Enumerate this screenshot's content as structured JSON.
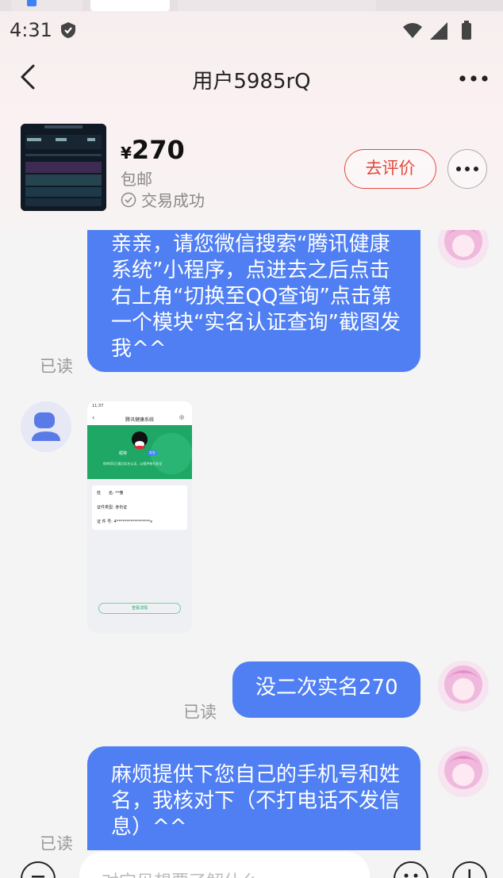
{
  "status_bar": {
    "time": "4:31"
  },
  "header": {
    "title": "用户5985rQ"
  },
  "order": {
    "currency": "¥",
    "price": "270",
    "shipping": "包邮",
    "status": "交易成功",
    "rate_button": "去评价"
  },
  "messages": [
    {
      "side": "right",
      "text": "亲亲，请您微信搜索“腾讯健康系统”小程序，点进去之后点击右上角“切换至QQ查询”点击第一个模块“实名认证查询”截图发我^^",
      "read": "已读"
    },
    {
      "side": "left",
      "type": "image"
    },
    {
      "side": "right",
      "text": "没二次实名270",
      "read": "已读"
    },
    {
      "side": "right",
      "text": "麻烦提供下您自己的手机号和姓名，我核对下（不打电话不发信息）^^",
      "read": "已读"
    }
  ],
  "screenshot_msg": {
    "time": "11:37",
    "app_title": "腾讯健康系统",
    "nickname": "昵称",
    "tag": "实名",
    "desc": "你的QQ已通过实名认证，以保护账号安全",
    "rows": [
      {
        "label": "姓　　名:",
        "value": "**懂"
      },
      {
        "label": "证件类型:",
        "value": "身份证"
      },
      {
        "label": "证 件 号:",
        "value": "4*****************x"
      }
    ],
    "button": "查看详情"
  },
  "input": {
    "placeholder": "对宝贝想要了解什么"
  },
  "icons": {
    "back": "back-arrow-icon",
    "more": "more-horizontal-icon",
    "check": "check-circle-icon",
    "menu": "menu-circle-icon",
    "emoji": "emoji-icon",
    "plus": "plus-circle-icon"
  },
  "colors": {
    "bubble_blue": "#4f7ff3",
    "accent_red": "#e24a3b",
    "green": "#1fa865"
  }
}
